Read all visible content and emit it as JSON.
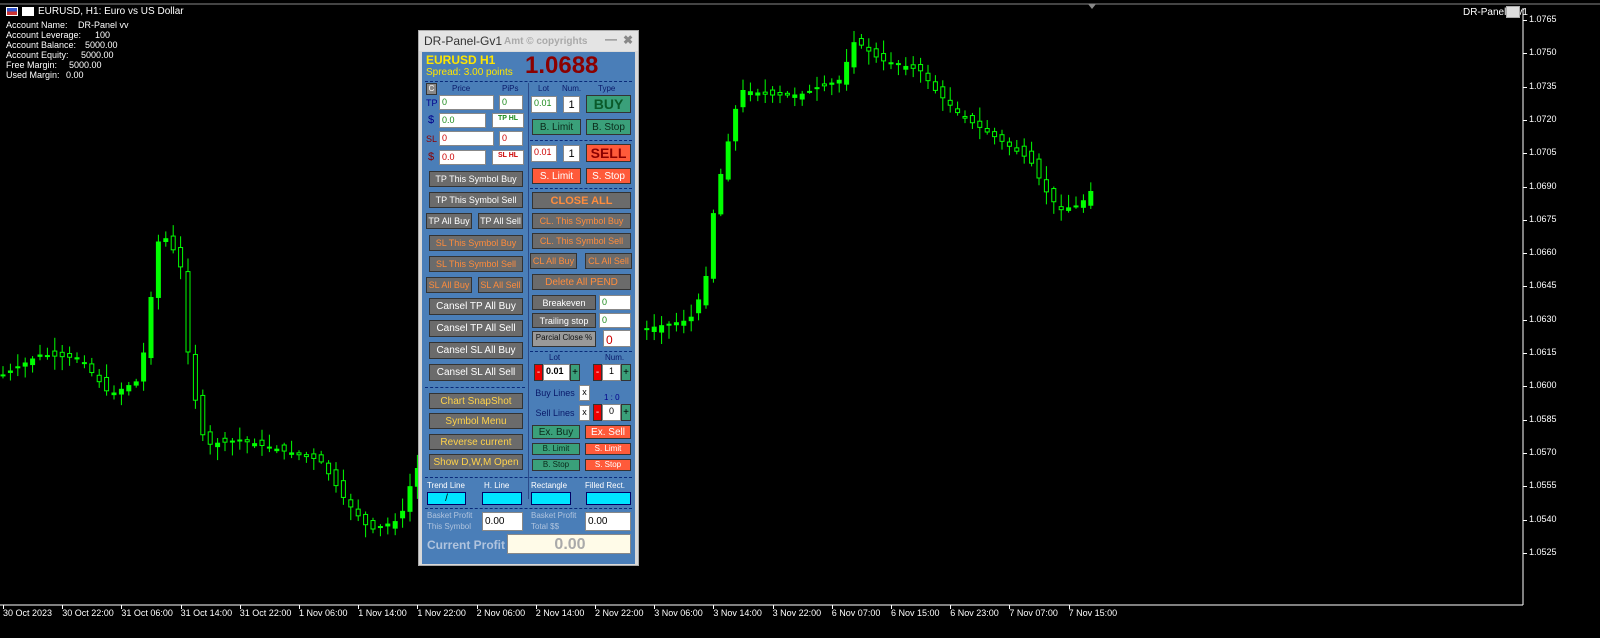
{
  "chart": {
    "symbol_title": "EURUSD, H1:  Euro vs US Dollar",
    "ea_name": "DR-Panel-Gv1",
    "account": [
      {
        "label": "Account Name:",
        "value": "DR-Panel vv"
      },
      {
        "label": "Account Leverage:",
        "value": "100"
      },
      {
        "label": "Account Balance:",
        "value": "5000.00"
      },
      {
        "label": "Account Equity:",
        "value": "5000.00"
      },
      {
        "label": "Free Margin:",
        "value": "5000.00"
      },
      {
        "label": "Used Margin:",
        "value": "0.00"
      }
    ],
    "price_scale": [
      "1.0765",
      "1.0750",
      "1.0735",
      "1.0720",
      "1.0705",
      "1.0690",
      "1.0675",
      "1.0660",
      "1.0645",
      "1.0630",
      "1.0615",
      "1.0600",
      "1.0585",
      "1.0570",
      "1.0555",
      "1.0540",
      "1.0525"
    ],
    "time_scale": [
      "30 Oct 2023",
      "30 Oct 22:00",
      "31 Oct 06:00",
      "31 Oct 14:00",
      "31 Oct 22:00",
      "1 Nov 06:00",
      "1 Nov 14:00",
      "1 Nov 22:00",
      "2 Nov 06:00",
      "2 Nov 14:00",
      "2 Nov 22:00",
      "3 Nov 06:00",
      "3 Nov 14:00",
      "3 Nov 22:00",
      "6 Nov 07:00",
      "6 Nov 15:00",
      "6 Nov 23:00",
      "7 Nov 07:00",
      "7 Nov 15:00"
    ],
    "colors": {
      "background": "#000000",
      "candle": "#00ff00",
      "axis": "#ffffff"
    }
  },
  "panel": {
    "title": "DR-Panel-Gv1",
    "copyright": "Amt © copyrights",
    "minimize": "—",
    "close": "✖",
    "symbol": "EURUSD",
    "timeframe": "H1",
    "spread": "Spread: 3.00 points",
    "price": "1.0688",
    "left": {
      "c": "C",
      "hdr_price": "Price",
      "hdr_pips": "PiPs",
      "tp": "TP",
      "tp_price": "0",
      "tp_pips": "0",
      "usd1": "$",
      "tp_money": "0.0",
      "tp_hl": "TP HL",
      "sl": "SL",
      "sl_price": "0",
      "sl_pips": "0",
      "usd2": "$",
      "sl_money": "0.0",
      "sl_hl": "SL HL",
      "tp_sym_buy": "TP This Symbol Buy",
      "tp_sym_sell": "TP This Symbol Sell",
      "tp_all_buy": "TP All Buy",
      "tp_all_sell": "TP All Sell",
      "sl_sym_buy": "SL This Symbol Buy",
      "sl_sym_sell": "SL This Symbol Sell",
      "sl_all_buy": "SL All Buy",
      "sl_all_sell": "SL All Sell",
      "c_tp_buy": "Cansel  TP  All Buy",
      "c_tp_sell": "Cansel  TP  All Sell",
      "c_sl_buy": "Cansel  SL  All Buy",
      "c_sl_sell": "Cansel  SL  All Sell",
      "snapshot": "Chart SnapShot",
      "symbol_menu": "Symbol Menu",
      "reverse": "Reverse current",
      "show_dwm": "Show D,W,M Open"
    },
    "right": {
      "hdr_lot": "Lot",
      "hdr_num": "Num.",
      "hdr_type": "Type",
      "buy_lot": "0.01",
      "buy_num": "1",
      "buy": "BUY",
      "b_limit": "B. Limit",
      "b_stop": "B. Stop",
      "sell_lot": "0.01",
      "sell_num": "1",
      "sell": "SELL",
      "s_limit": "S. Limit",
      "s_stop": "S. Stop",
      "close_all": "CLOSE  ALL",
      "cl_sym_buy": "CL. This Symbol Buy",
      "cl_sym_sell": "CL. This Symbol Sell",
      "cl_all_buy": "CL All Buy",
      "cl_all_sell": "CL All Sell",
      "del_pend": "Delete All PEND",
      "breakeven": "Breakeven",
      "breakeven_val": "0",
      "trailing": "Trailing stop",
      "trailing_val": "0",
      "partial": "Parcial Close  %",
      "partial_val": "0",
      "lot2_lbl": "Lot",
      "num2_lbl": "Num.",
      "minus": "-",
      "plus": "+",
      "lot2": "0.01",
      "num2": "1",
      "buy_lines": "Buy Lines",
      "sell_lines": "Sell Lines",
      "x": "x",
      "ratio": "1 : 0",
      "ratio_val": "0",
      "ex_buy": "Ex. Buy",
      "ex_sell": "Ex. Sell",
      "b_limit2": "B. Limit",
      "s_limit2": "S. Limit",
      "b_stop2": "B. Stop",
      "s_stop2": "S. Stop"
    },
    "drawing": {
      "trend_line": "Trend Line",
      "h_line": "H. Line",
      "rectangle": "Rectangle",
      "filled_rect": "Filled Rect.",
      "trend_glyph": "/"
    },
    "basket": {
      "symbol_label_1": "Basket Profit",
      "symbol_label_2": "This Symbol",
      "symbol_val": "0.00",
      "total_label_1": "Basket Profit",
      "total_label_2": "Total $$",
      "total_val": "0.00",
      "current_label": "Current Profit",
      "current_val": "0.00"
    }
  }
}
